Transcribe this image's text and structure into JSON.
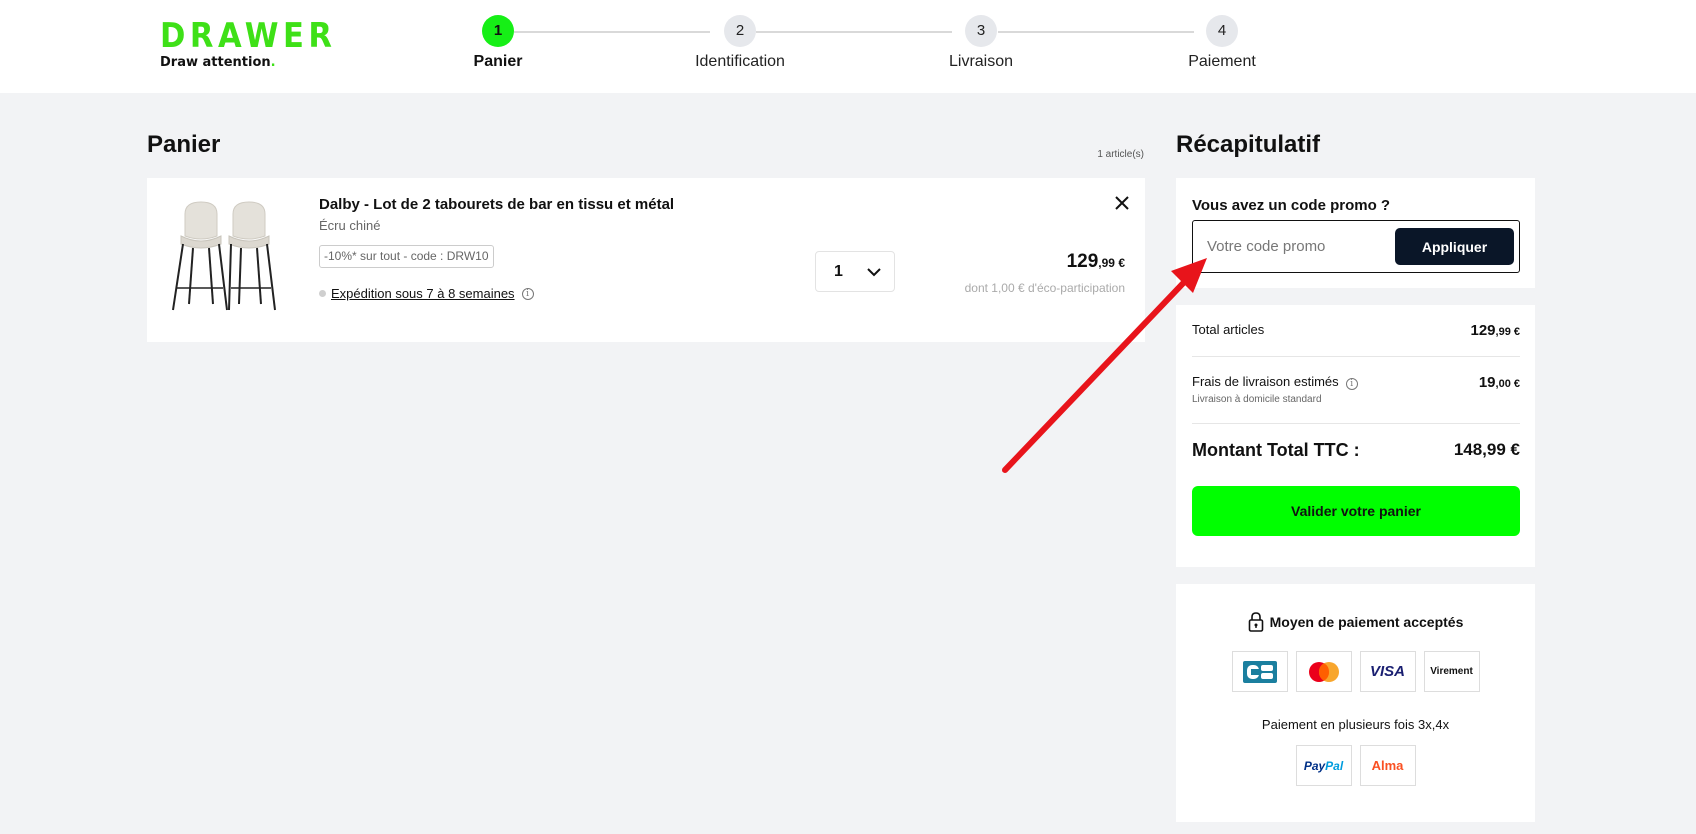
{
  "brand": {
    "name": "DRAWER",
    "tagline": "Draw attention",
    "tagline_dot": ".",
    "color": "#3ee017"
  },
  "steps": [
    {
      "number": "1",
      "label": "Panier",
      "active": true
    },
    {
      "number": "2",
      "label": "Identification",
      "active": false
    },
    {
      "number": "3",
      "label": "Livraison",
      "active": false
    },
    {
      "number": "4",
      "label": "Paiement",
      "active": false
    }
  ],
  "cart": {
    "title": "Panier",
    "count_label": "1 article(s)",
    "item": {
      "name": "Dalby - Lot de 2 tabourets de bar en tissu et métal",
      "variant": "Écru chiné",
      "promo_chip": "-10%* sur tout - code : DRW10",
      "shipping": "Expédition sous 7 à 8 semaines",
      "quantity": "1",
      "price_int": "129",
      "price_dec": ",99 €",
      "eco": "dont 1,00 € d'éco-participation"
    }
  },
  "summary": {
    "title": "Récapitulatif",
    "promo_question": "Vous avez un code promo ?",
    "promo_placeholder": "Votre code promo",
    "apply_label": "Appliquer",
    "total_articles_label": "Total articles",
    "total_articles_int": "129",
    "total_articles_dec": ",99 €",
    "shipping_label": "Frais de livraison estimés",
    "shipping_sub": "Livraison à domicile standard",
    "shipping_int": "19",
    "shipping_dec": ",00 €",
    "grand_total_label": "Montant Total TTC :",
    "grand_total_value": "148,99 €",
    "validate_label": "Valider votre panier"
  },
  "payment": {
    "title": "Moyen de paiement acceptés",
    "methods": [
      "CB",
      "Mastercard",
      "VISA",
      "Virement"
    ],
    "multi_text": "Paiement en plusieurs fois 3x,4x",
    "multi_methods": [
      "PayPal",
      "Alma"
    ]
  },
  "colors": {
    "accent_green": "#00ff00",
    "dark_button": "#0a1628",
    "annotation_arrow": "#e8141b"
  }
}
